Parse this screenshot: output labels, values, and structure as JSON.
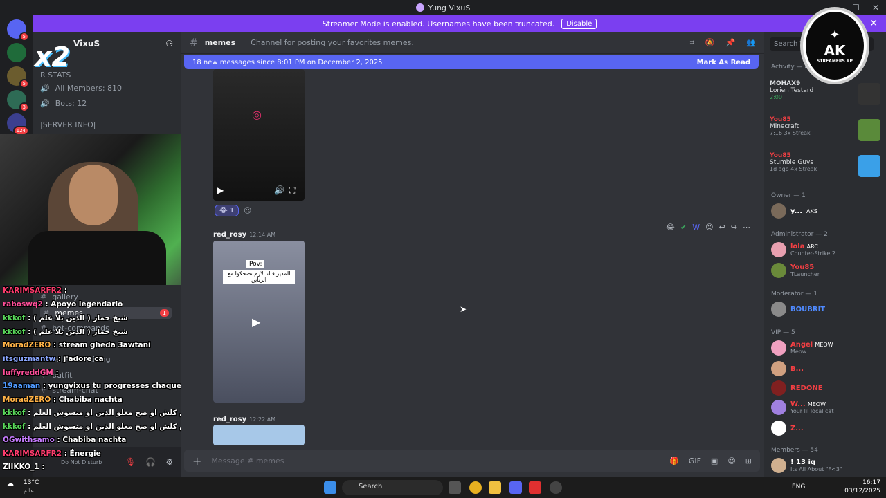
{
  "window": {
    "title": "Yung VixuS"
  },
  "banner": {
    "text": "Streamer Mode is enabled. Usernames have been truncated.",
    "disable_label": "Disable"
  },
  "guild": {
    "name": "VixuS"
  },
  "sidebar": {
    "channels": [
      {
        "label": "R STATS"
      },
      {
        "label": "All Members: 810"
      },
      {
        "label": "Bots: 12"
      },
      {
        "label": "|SERVER INFO|"
      },
      {
        "label": "gallery"
      },
      {
        "label": "memes",
        "badge": "1"
      },
      {
        "label": "bot-commands"
      },
      {
        "label": "self-advertising"
      },
      {
        "label": "outfit"
      },
      {
        "label": "stream-chat"
      }
    ]
  },
  "chat_overlay": [
    {
      "user": "KARIMSARFR2",
      "msg": ":"
    },
    {
      "user": "raboswq2",
      "msg": ": Apoyo legendario"
    },
    {
      "user": "kkkof",
      "msg": ": ( شيخ حمار ( الذين بلا علم"
    },
    {
      "user": "kkkof",
      "msg": ": ( شيخ حمار ( الذين بلا علم"
    },
    {
      "user": "MoradZERO",
      "msg": ": stream gheda 3awtani"
    },
    {
      "user": "itsguzmantw",
      "msg": ": j'adore ca"
    },
    {
      "user": "luffyreddGM",
      "msg": ":"
    },
    {
      "user": "19aaman",
      "msg": ": yungvixus tu progresses chaque jour"
    },
    {
      "user": "MoradZERO",
      "msg": ": Chabiba nachta"
    },
    {
      "user": "kkkof",
      "msg": ": ربي ميمش كلش او صح مغلو الذين او منسوش العلم"
    },
    {
      "user": "kkkof",
      "msg": ": ربي ميمش كلش او صح مغلو الذين او منسوش العلم"
    },
    {
      "user": "OGwithsamo",
      "msg": ": Chabiba nachta"
    },
    {
      "user": "KARIMSARFR2",
      "msg": ": Énergie"
    },
    {
      "user": "ZIIKKO_1",
      "msg": ":"
    }
  ],
  "overlay_badge": "x2",
  "user_panel": {
    "status": "Do Not Disturb"
  },
  "channel": {
    "name": "memes",
    "topic": "Channel for posting your favorites memes.",
    "new_messages": "18 new messages since 8:01 PM on December 2, 2025",
    "mark_read": "Mark As Read"
  },
  "messages": [
    {
      "author": "red_rosy",
      "time": "12:14 AM",
      "caption_top": "Pov:",
      "caption": "المدير قالنا لازم تضحكوا مع الزباين"
    },
    {
      "author": "red_rosy",
      "time": "12:22 AM"
    }
  ],
  "reaction": {
    "count": "1"
  },
  "composer": {
    "placeholder": "Message # memes"
  },
  "members": {
    "search_placeholder": "Search Yu",
    "activity_label": "Activity — 8",
    "activities": [
      {
        "name": "MOHAX9",
        "title": "Lorien Testard",
        "meta": "2:00"
      },
      {
        "name": "You85",
        "title": "Minecraft",
        "meta": "7:16  3x Streak"
      },
      {
        "name": "You85",
        "title": "Stumble Guys",
        "meta": "1d ago  4x Streak"
      }
    ],
    "sections": [
      {
        "label": "Owner — 1"
      },
      {
        "label": "Administrator — 2"
      },
      {
        "label": "Moderator — 1"
      },
      {
        "label": "VIP — 5"
      },
      {
        "label": "Members — 54"
      }
    ],
    "people": [
      {
        "name": "y...",
        "tag": "AKS",
        "sub": ""
      },
      {
        "name": "lola",
        "tag": "ARC",
        "sub": "Counter-Strike 2"
      },
      {
        "name": "You85",
        "tag": "",
        "sub": "TLauncher"
      },
      {
        "name": "BOUBRIT",
        "tag": "",
        "sub": ""
      },
      {
        "name": "Angel",
        "tag": "MEOW",
        "sub": "Meow"
      },
      {
        "name": "B...",
        "tag": "",
        "sub": ""
      },
      {
        "name": "REDONE",
        "tag": "",
        "sub": ""
      },
      {
        "name": "W...",
        "tag": "MEOW",
        "sub": "Your lil local cat"
      },
      {
        "name": "Z...",
        "tag": "",
        "sub": ""
      },
      {
        "name": "! 13 iq",
        "tag": "",
        "sub": "Its All About \"F<3\""
      }
    ]
  },
  "logo": {
    "text": "AK",
    "sub": "STREAMERS RP"
  },
  "taskbar": {
    "weather": "13°C",
    "weather_sub": "عالم",
    "search": "Search",
    "lang": "ENG",
    "time": "16:17",
    "date": "03/12/2025"
  },
  "colors": {
    "accent": "#5865f2",
    "banner": "#7b3ff0",
    "danger": "#f23f43"
  }
}
